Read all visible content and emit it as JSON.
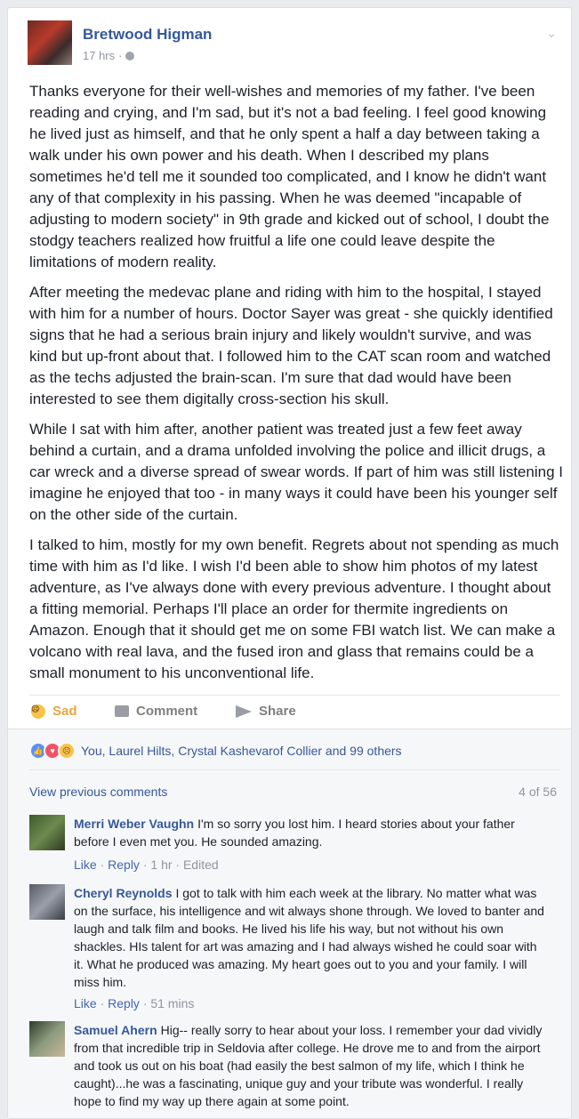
{
  "post": {
    "author": "Bretwood Higman",
    "time": "17 hrs",
    "separator": "·",
    "paragraphs": [
      "Thanks everyone for their well-wishes and memories of my father. I've been reading and crying, and I'm sad, but it's not a bad feeling. I feel good knowing he lived just as himself, and that he only spent a half a day between taking a walk under his own power and his death. When I described my plans sometimes he'd tell me it sounded too complicated, and I know he didn't want any of that complexity in his passing. When he was deemed \"incapable of adjusting to modern society\" in 9th grade and kicked out of school, I doubt the stodgy teachers realized how fruitful a life one could leave despite the limitations of modern reality.",
      "After meeting the medevac plane and riding with him to the hospital, I stayed with him for a number of hours. Doctor Sayer was great - she quickly identified signs that he had a serious brain injury and likely wouldn't survive, and was kind but up-front about that. I followed him to the CAT scan room and watched as the techs adjusted the brain-scan. I'm sure that dad would have been interested to see them digitally cross-section his skull.",
      "While I sat with him after, another patient was treated just a few feet away behind a curtain, and a drama unfolded involving the police and illicit drugs, a car wreck and a diverse spread of swear words. If part of him was still listening I imagine he enjoyed that too - in many ways it could have been his younger self on the other side of the curtain.",
      "I talked to him, mostly for my own benefit. Regrets about not spending as much time with him as I'd like. I wish I'd been able to show him photos of my latest adventure, as I've always done with every previous adventure. I thought about a fitting memorial. Perhaps I'll place an order for thermite ingredients on Amazon. Enough that it should get me on some FBI watch list. We can make a volcano with real lava, and the fused iron and glass that remains could be a small monument to his unconventional life."
    ]
  },
  "actions": {
    "sad": "Sad",
    "comment": "Comment",
    "share": "Share"
  },
  "reactions": {
    "summary": "You, Laurel Hilts, Crystal Kashevarof Collier and 99 others"
  },
  "comments_section": {
    "view_previous": "View previous comments",
    "counter": "4 of 56",
    "comments": [
      {
        "name": "Merri Weber Vaughn",
        "text": "I'm so sorry you lost him. I heard stories about your father before I even met you. He sounded amazing.",
        "like": "Like",
        "reply": "Reply",
        "time": "1 hr",
        "edited": "Edited"
      },
      {
        "name": "Cheryl Reynolds",
        "text": "I got to talk with him each week at the library. No matter what was on the surface, his intelligence and wit always shone through. We loved to banter and laugh and talk film and books. He lived his life his way, but not without his own shackles. HIs talent for art was amazing and I had always wished he could soar with it. What he produced was amazing. My heart goes out to you and your family. I will miss him.",
        "like": "Like",
        "reply": "Reply",
        "time": "51 mins"
      },
      {
        "name": "Samuel Ahern",
        "text": "Hig-- really sorry to hear about your loss. I remember your dad vividly from that incredible trip in Seldovia after college. He drove me to and from the airport and took us out on his boat (had easily the best salmon of my life, which I think he caught)...he was a fascinating, unique guy and your tribute was wonderful. I really hope to find my way up there again at some point."
      }
    ]
  },
  "colors": {
    "link": "#365899",
    "sad_accent": "#e9a53e",
    "muted": "#90949c"
  }
}
